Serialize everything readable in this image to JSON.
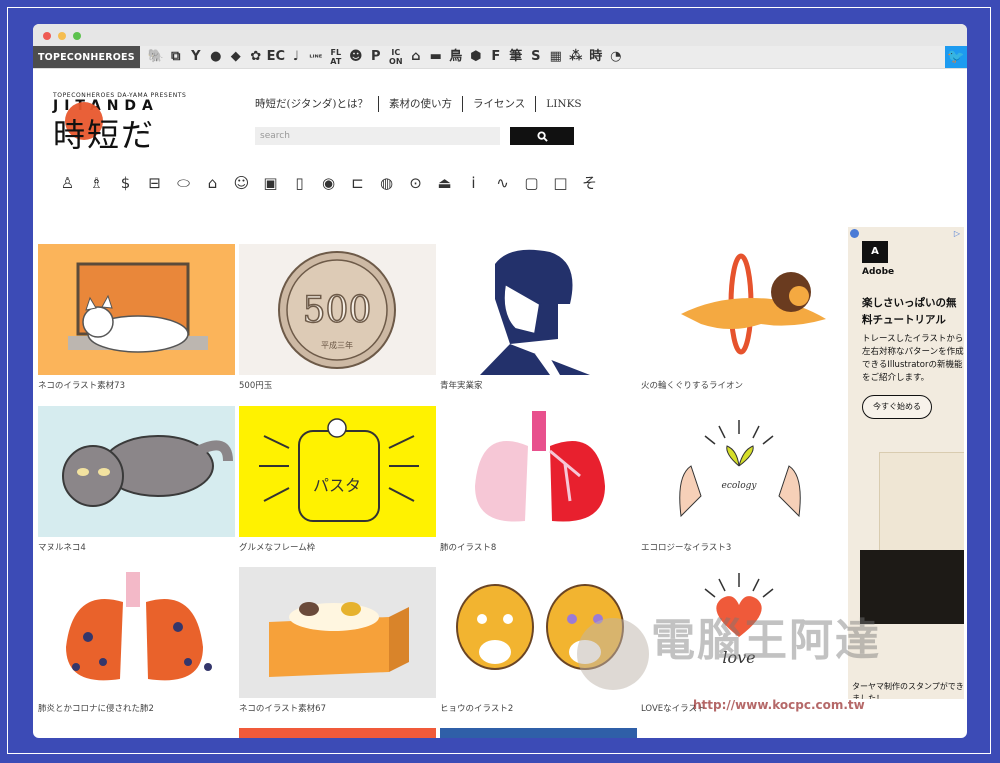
{
  "topbar": {
    "brand": "TOPECONHEROES",
    "site_icons": [
      "🐘",
      "⧉",
      "Y",
      "●",
      "◆",
      "✿",
      "EC",
      "♩",
      "ᴸᴵᴺᴱ",
      "FL AT",
      "☻",
      "P",
      "IC ON",
      "⌂",
      "▬",
      "鳥",
      "⬢",
      "F",
      "筆",
      "S",
      "▦",
      "⁂",
      "時",
      "◔"
    ]
  },
  "header": {
    "logo_top": "TOPECONHEROES DA-YAMA PRESENTS",
    "logo_name": "JITANDA",
    "logo_jp": "時短だ",
    "nav": [
      "時短だ(ジタンダ)とは？",
      "素材の使い方",
      "ライセンス",
      "LINKS"
    ],
    "search_placeholder": "search"
  },
  "categories": [
    "♙",
    "♗",
    "$",
    "⊟",
    "⬭",
    "⌂",
    "☺",
    "▣",
    "▯",
    "◉",
    "⊏",
    "◍",
    "⊙",
    "⏏",
    "i",
    "∿",
    "▢",
    "□",
    "そ"
  ],
  "grid": [
    {
      "caption": "ネコのイラスト素材73"
    },
    {
      "caption": "500円玉",
      "coin": "500",
      "coin_sub": "平成三年"
    },
    {
      "caption": "青年実業家"
    },
    {
      "caption": "火の輪くぐりするライオン"
    },
    {
      "caption": "マヌルネコ4"
    },
    {
      "caption": "グルメなフレーム枠",
      "art_text": "パスタ"
    },
    {
      "caption": "肺のイラスト8"
    },
    {
      "caption": "エコロジーなイラスト3",
      "art_text": "ecology"
    },
    {
      "caption": "肺炎とかコロナに侵された肺2"
    },
    {
      "caption": "ネコのイラスト素材67"
    },
    {
      "caption": "ヒョウのイラスト2"
    },
    {
      "caption": "LOVEなイラスト",
      "art_text": "love"
    }
  ],
  "ad": {
    "brand": "Adobe",
    "headline": "楽しさいっぱいの無料チュートリアル",
    "body": "トレースしたイラストから左右対称なパターンを作成できるIllustratorの新機能をご紹介します。",
    "cta": "今すぐ始める",
    "caption": "ターヤマ制作のスタンプができました！"
  },
  "watermark": {
    "text": "電腦王阿達",
    "url": "http://www.kocpc.com.tw"
  }
}
